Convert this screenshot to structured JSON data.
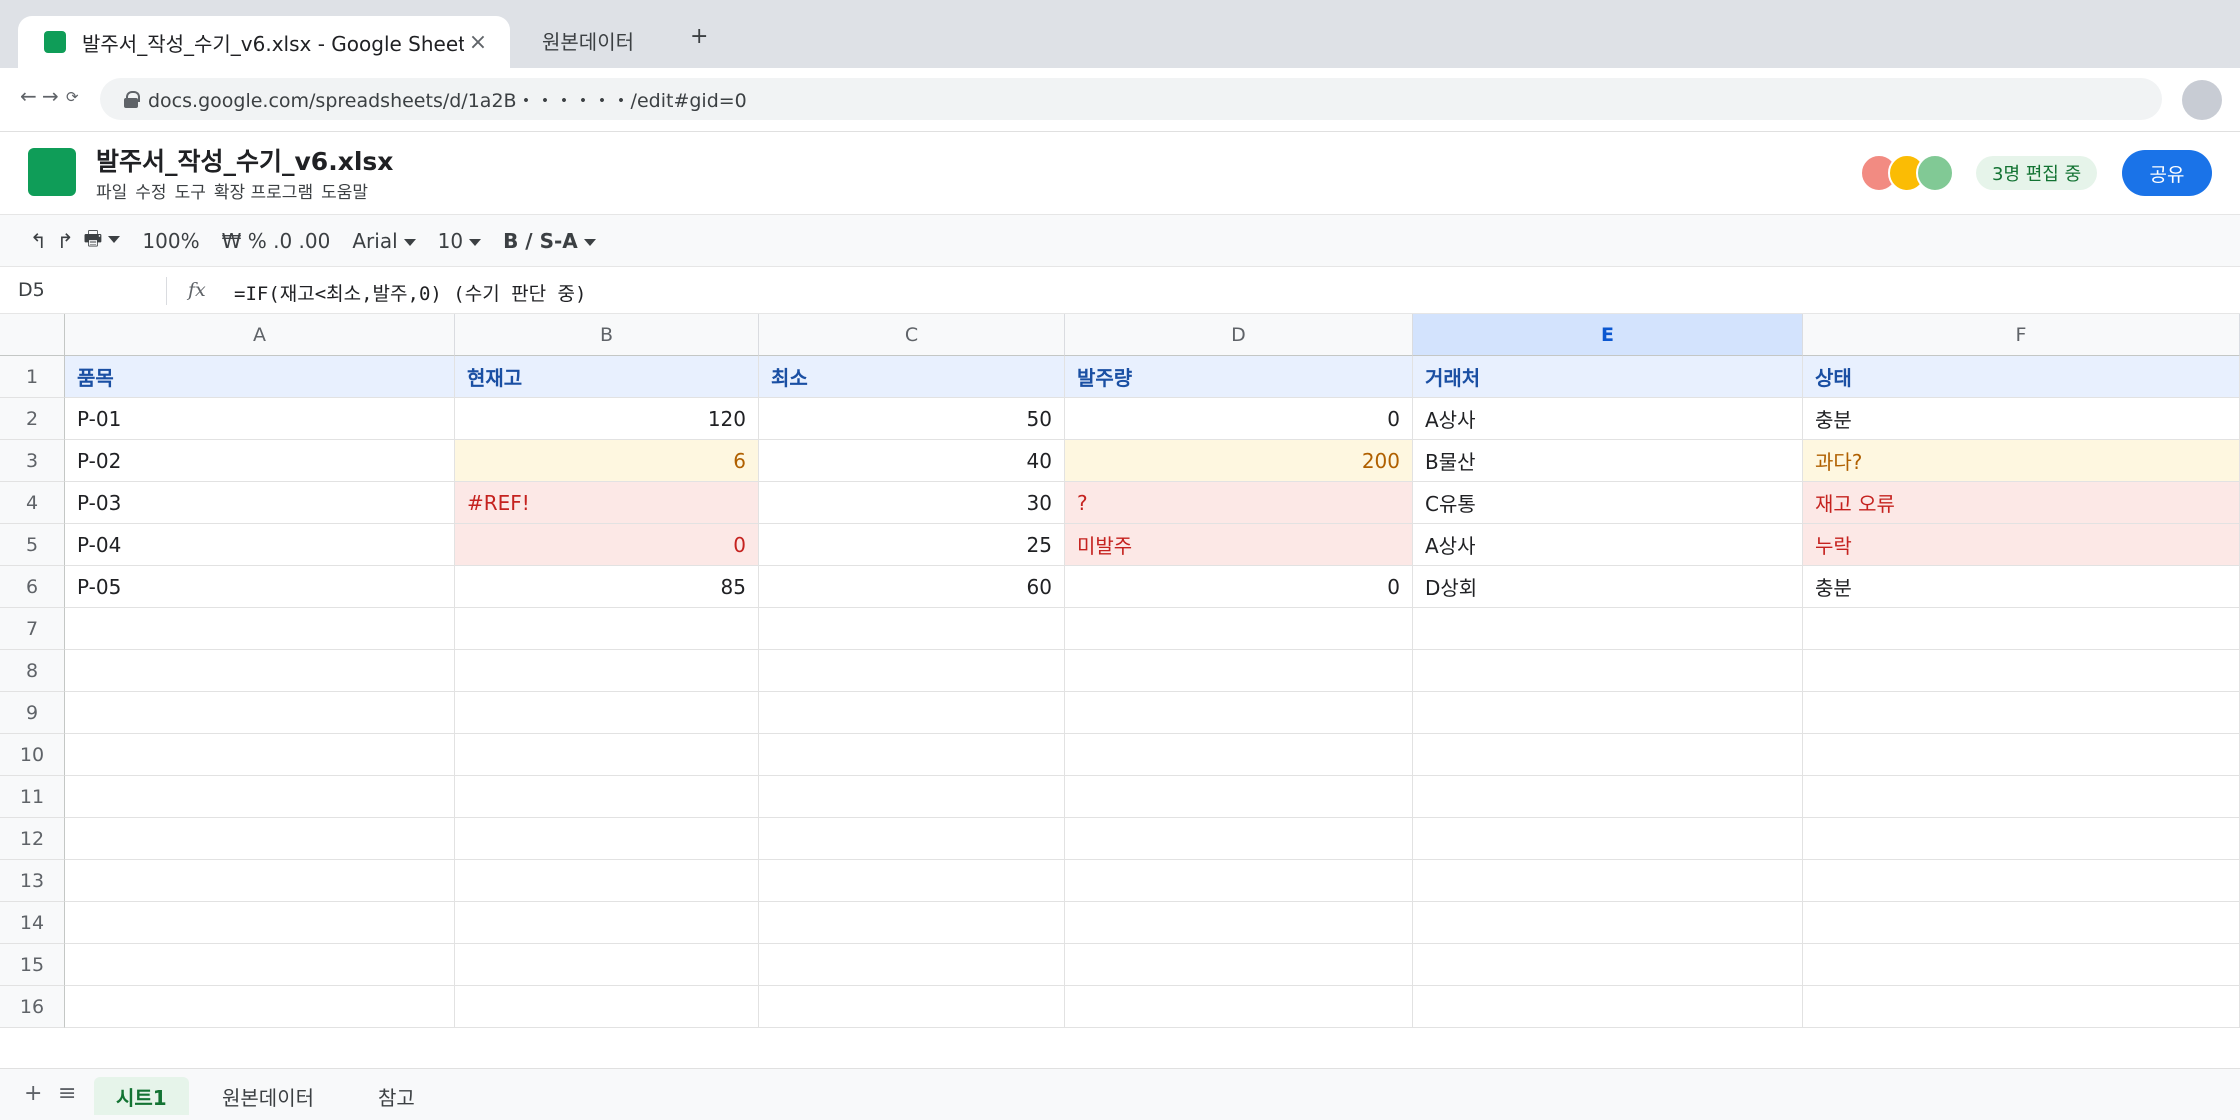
{
  "browser": {
    "active_tab_title": "발주서_작성_수기_v6.xlsx - Google Sheets",
    "close_glyph": "×",
    "inactive_tab_title": "원본데이터",
    "new_tab_glyph": "+",
    "back_glyph": "←",
    "forward_glyph": "→",
    "reload_glyph": "⟳",
    "url": "docs.google.com/spreadsheets/d/1a2B・・・・・・/edit#gid=0"
  },
  "doc": {
    "title": "발주서_작성_수기_v6.xlsx",
    "menu": [
      "파일",
      "수정",
      "도구",
      "확장 프로그램",
      "도움말"
    ],
    "editing_badge": "3명 편집 중",
    "share_label": "공유",
    "avatar_colors": [
      "#f28b82",
      "#fbbc04",
      "#81c995"
    ]
  },
  "toolbar": {
    "undo": "↰",
    "redo": "↱",
    "print": "🖶",
    "zoom": "100%",
    "number_formats": "₩ % .0 .00",
    "font": "Arial",
    "font_size": "10",
    "text_style": "B / S-A"
  },
  "formula_bar": {
    "cell_ref": "D5",
    "fx": "fx",
    "formula": "=IF(재고<최소,발주,0) (수기 판단 중)"
  },
  "grid": {
    "columns": [
      "A",
      "B",
      "C",
      "D",
      "E",
      "F"
    ],
    "selected_column": "E",
    "row_numbers": [
      "1",
      "2",
      "3",
      "4",
      "5",
      "6",
      "7",
      "8",
      "9",
      "10",
      "11",
      "12",
      "13",
      "14",
      "15",
      "16"
    ],
    "header": [
      "품목",
      "현재고",
      "최소",
      "발주량",
      "거래처",
      "상태"
    ],
    "rows": [
      [
        "P-01",
        "120",
        "50",
        "0",
        "A상사",
        "충분"
      ],
      [
        "P-02",
        "6",
        "40",
        "200",
        "B물산",
        "과다?"
      ],
      [
        "P-03",
        "#REF!",
        "30",
        "?",
        "C유통",
        "재고 오류"
      ],
      [
        "P-04",
        "0",
        "25",
        "미발주",
        "A상사",
        "누락"
      ],
      [
        "P-05",
        "85",
        "60",
        "0",
        "D상회",
        "충분"
      ]
    ]
  },
  "sheets": {
    "add": "+",
    "list": "≡",
    "tabs": [
      "시트1",
      "원본데이터",
      "참고"
    ],
    "active": "시트1"
  }
}
